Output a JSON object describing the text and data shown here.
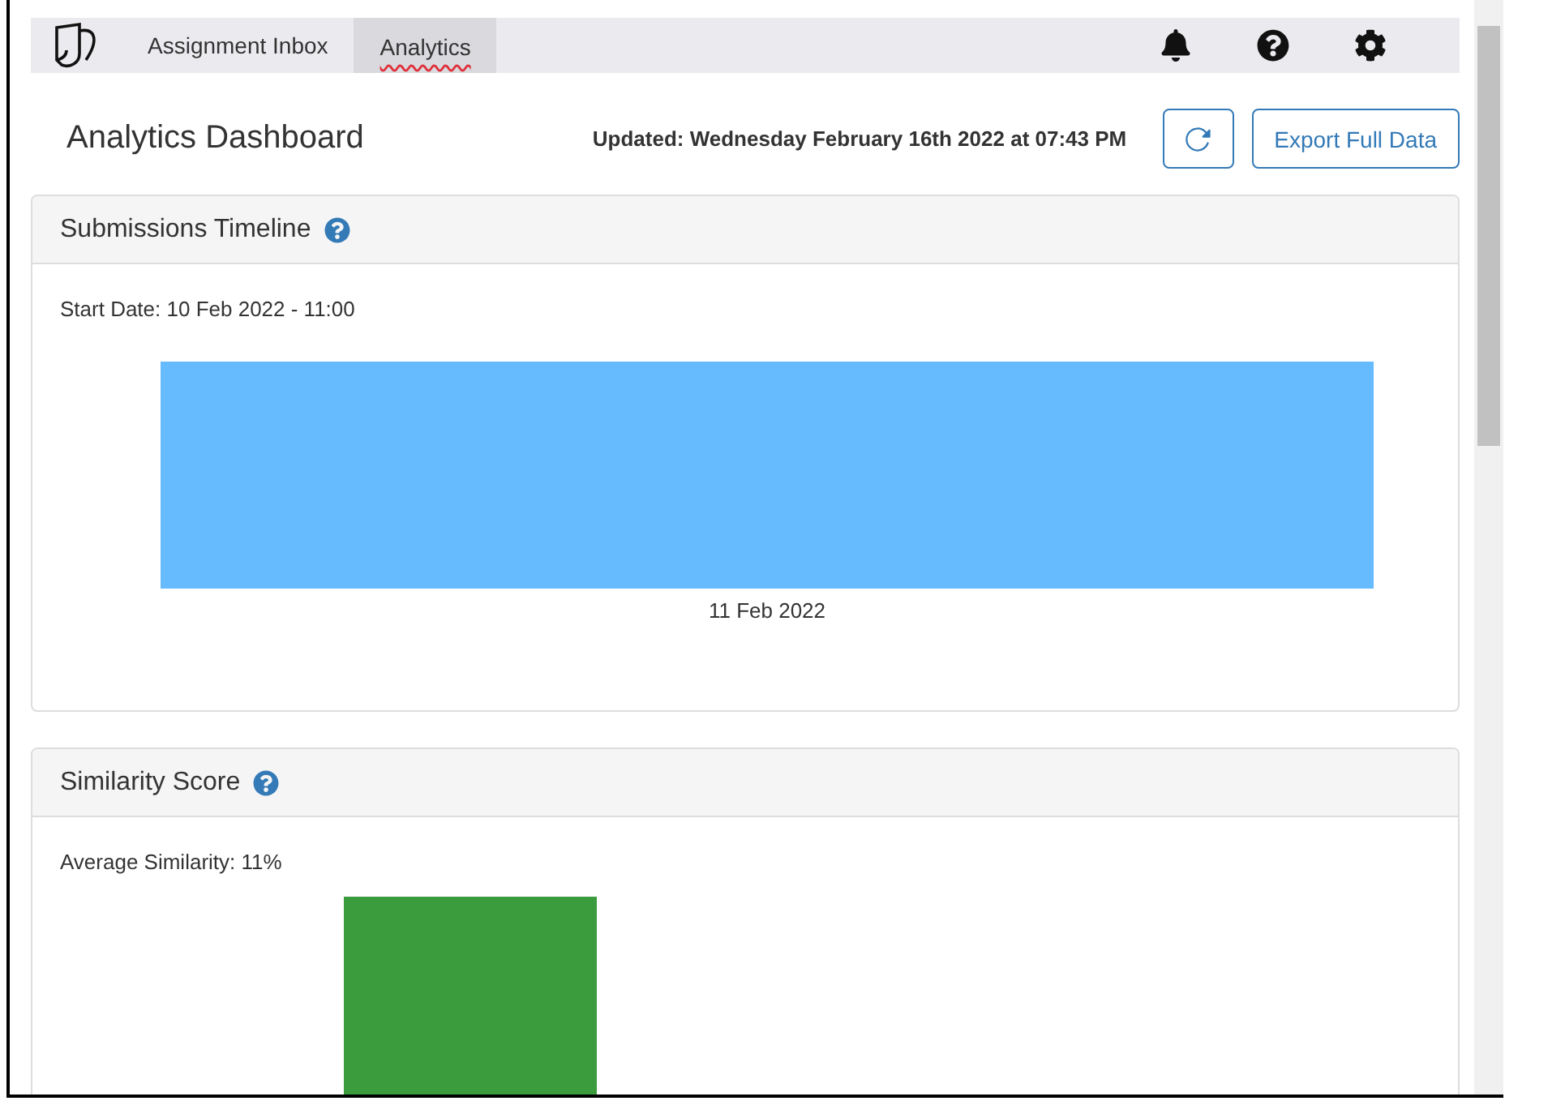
{
  "navbar": {
    "tabs": [
      {
        "label": "Assignment Inbox",
        "selected": false
      },
      {
        "label": "Analytics",
        "selected": true
      }
    ]
  },
  "header": {
    "title": "Analytics Dashboard",
    "updated": "Updated: Wednesday February 16th 2022 at 07:43 PM",
    "export_button": "Export Full Data"
  },
  "cards": [
    {
      "kind": "timeline",
      "title": "Submissions Timeline",
      "summary": "Start Date: 10 Feb 2022 - 11:00",
      "bar_label": "11 Feb 2022"
    },
    {
      "kind": "similarity",
      "title": "Similarity Score",
      "summary": "Average Similarity: 11%"
    }
  ]
}
